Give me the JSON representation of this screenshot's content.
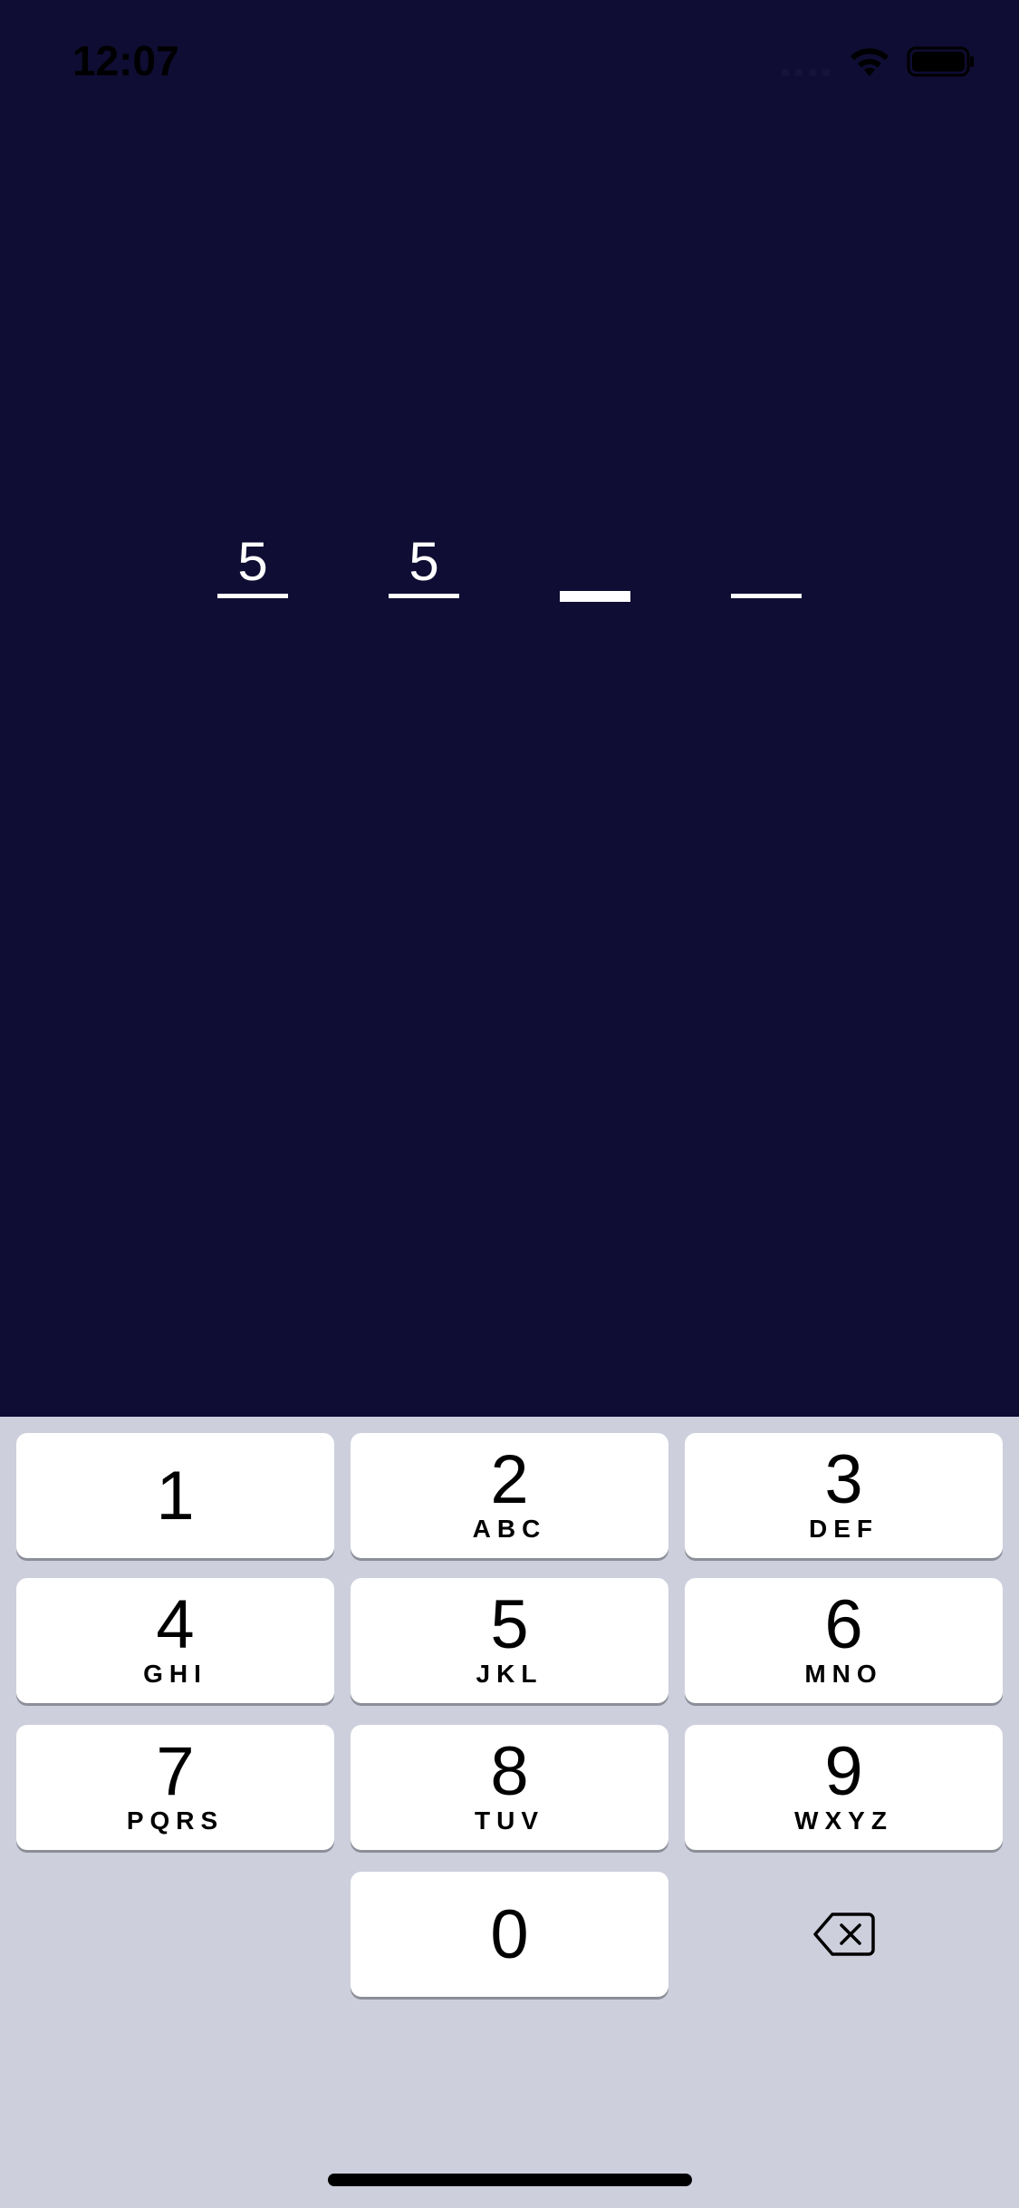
{
  "status_bar": {
    "time": "12:07",
    "icons": [
      "cellular-signal-icon",
      "wifi-icon",
      "battery-icon"
    ]
  },
  "pin": {
    "length": 4,
    "entered": [
      "5",
      "5",
      "",
      ""
    ],
    "active_index": 2
  },
  "keypad": {
    "keys": [
      {
        "digit": "1",
        "letters": ""
      },
      {
        "digit": "2",
        "letters": "ABC"
      },
      {
        "digit": "3",
        "letters": "DEF"
      },
      {
        "digit": "4",
        "letters": "GHI"
      },
      {
        "digit": "5",
        "letters": "JKL"
      },
      {
        "digit": "6",
        "letters": "MNO"
      },
      {
        "digit": "7",
        "letters": "PQRS"
      },
      {
        "digit": "8",
        "letters": "TUV"
      },
      {
        "digit": "9",
        "letters": "WXYZ"
      },
      {
        "digit": "0",
        "letters": ""
      }
    ],
    "delete_icon": "backspace-icon"
  },
  "colors": {
    "background": "#0f0d33",
    "keypad_background": "#cdcfdd",
    "key_background": "#ffffff",
    "pin_text": "#ffffff"
  }
}
